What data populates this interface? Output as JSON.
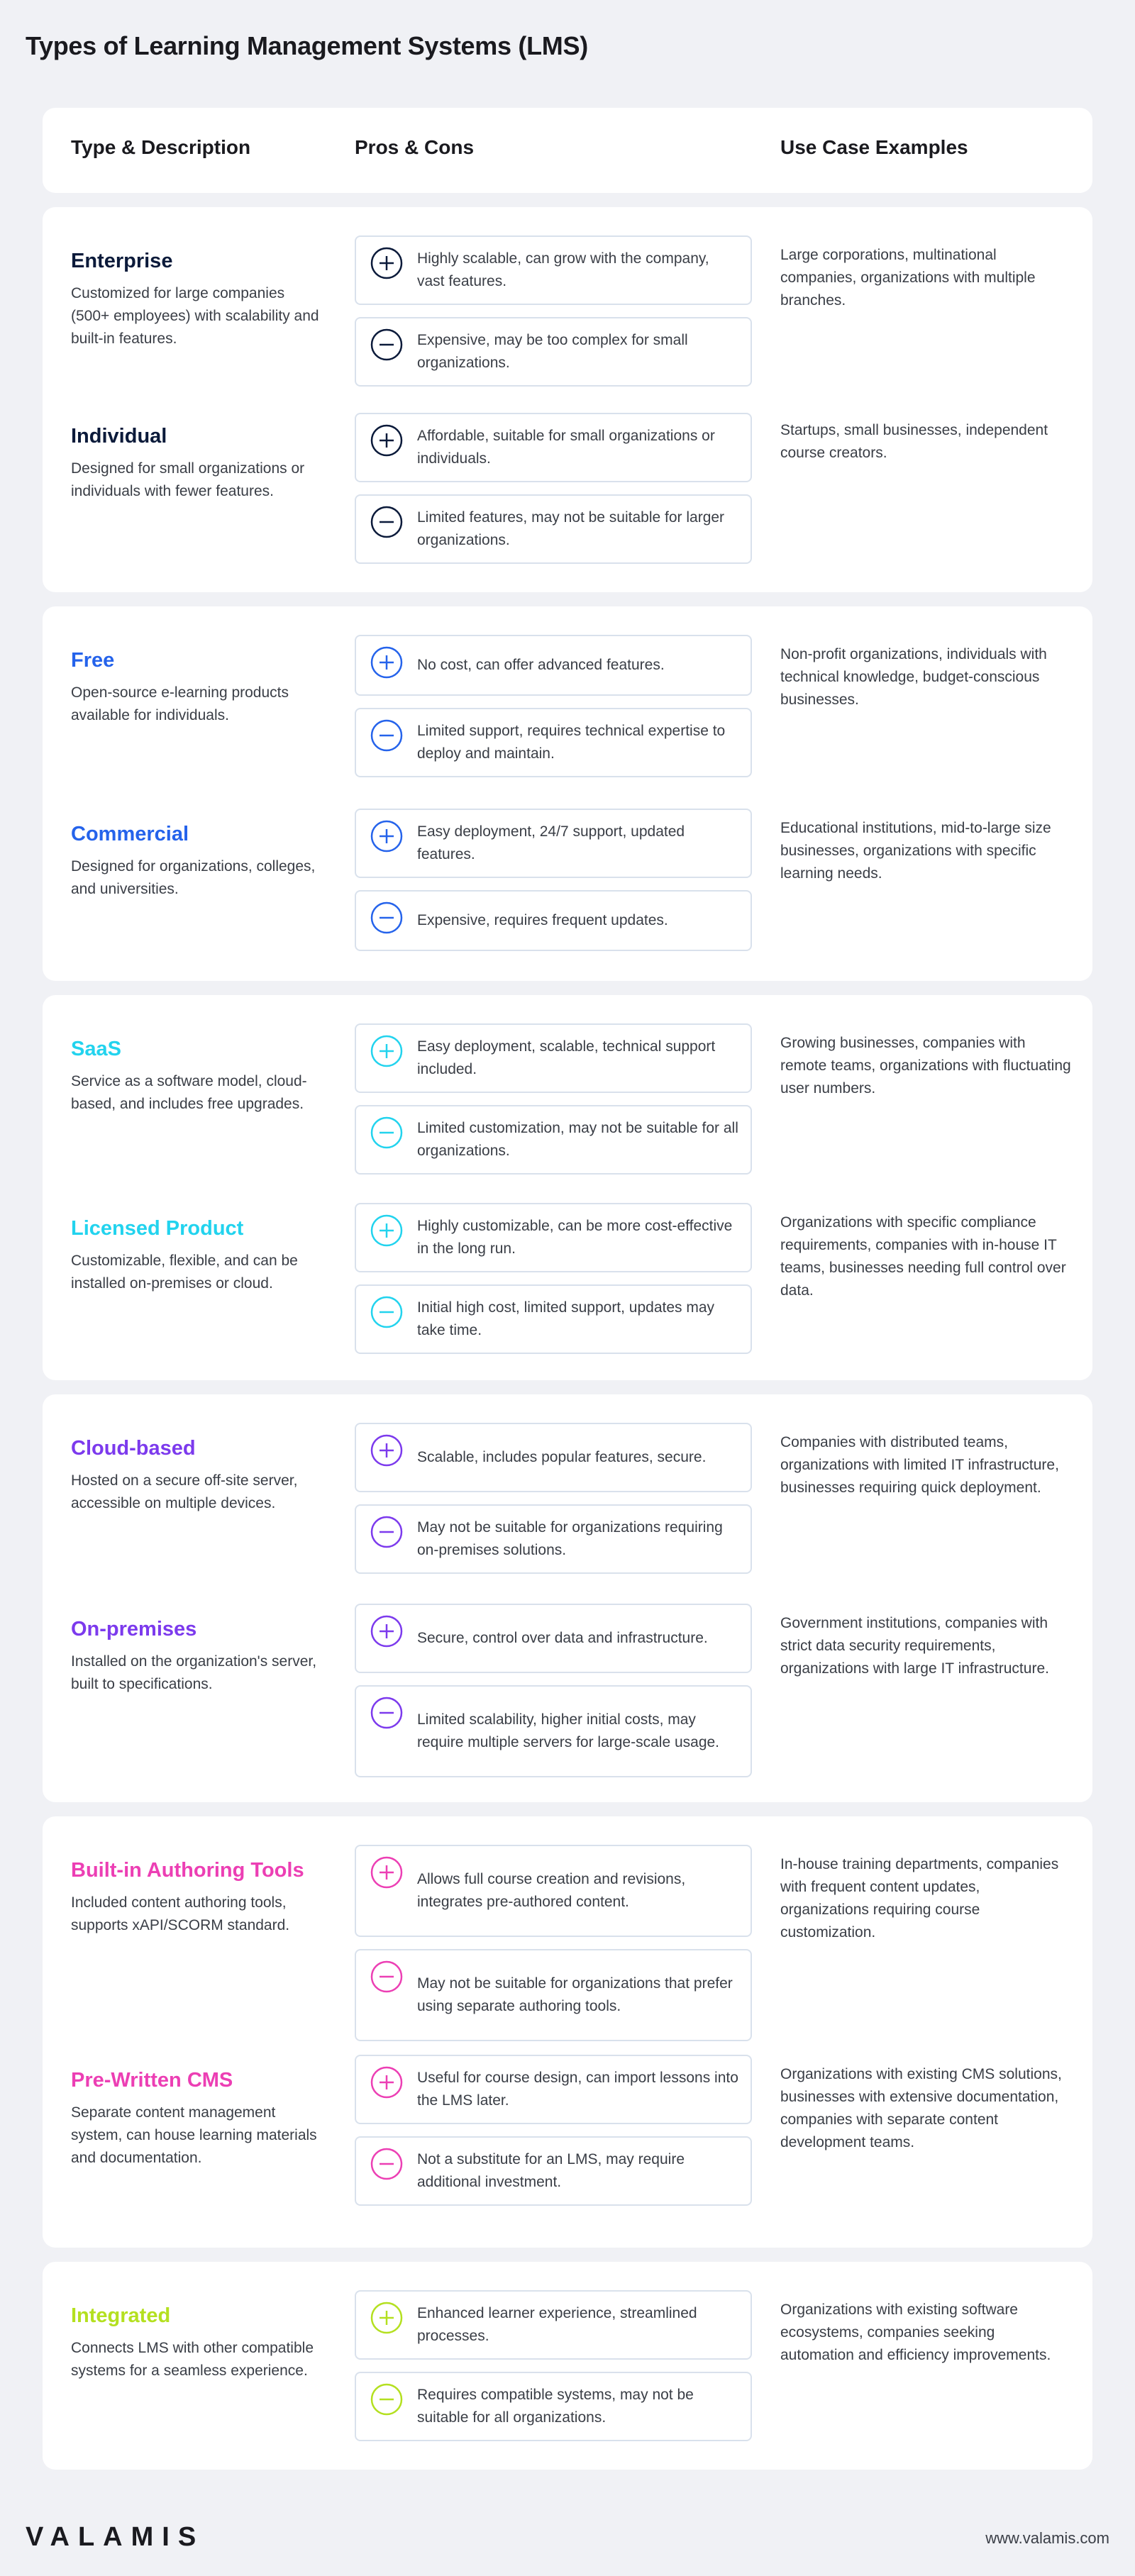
{
  "title": "Types of Learning Management Systems (LMS)",
  "columns": {
    "type": "Type & Description",
    "pros_cons": "Pros & Cons",
    "use_cases": "Use Case Examples"
  },
  "groups": [
    {
      "color": "#0b1a3a",
      "items": [
        {
          "name": "Enterprise",
          "desc": "Customized for large companies (500+ employees) with scalability and built-in features.",
          "pro": "Highly scalable, can grow with the company, vast features.",
          "con": "Expensive, may be too complex for small organizations.",
          "use": "Large corporations, multinational companies, organizations with multiple branches."
        },
        {
          "name": "Individual",
          "desc": "Designed for small organizations or individuals with fewer features.",
          "pro": "Affordable, suitable for small organizations or individuals.",
          "con": "Limited features, may not be suitable for larger organizations.",
          "use": "Startups, small businesses, independent course creators."
        }
      ]
    },
    {
      "color": "#2563eb",
      "items": [
        {
          "name": "Free",
          "desc": "Open-source e-learning products available for individuals.",
          "pro": "No cost, can offer advanced features.",
          "con": "Limited support, requires technical expertise to deploy and maintain.",
          "use": "Non-profit organizations, individuals with technical knowledge, budget-conscious businesses."
        },
        {
          "name": "Commercial",
          "desc": "Designed for organizations, colleges, and universities.",
          "pro": "Easy deployment, 24/7 support, updated features.",
          "con": "Expensive, requires frequent updates.",
          "use": "Educational institutions, mid-to-large size businesses, organizations with specific learning needs."
        }
      ]
    },
    {
      "color": "#22d3ee",
      "items": [
        {
          "name": "SaaS",
          "desc": "Service as a software model, cloud-based, and includes free upgrades.",
          "pro": "Easy deployment, scalable, technical support included.",
          "con": "Limited customization, may not be suitable for all organizations.",
          "use": "Growing businesses, companies with remote teams, organizations with fluctuating user numbers."
        },
        {
          "name": "Licensed Product",
          "desc": "Customizable, flexible, and can be installed on-premises or cloud.",
          "pro": "Highly customizable, can be more cost-effective in the long run.",
          "con": "Initial high cost, limited support, updates may take time.",
          "use": "Organizations with specific compliance requirements, companies with in-house IT teams, businesses needing full control over data."
        }
      ]
    },
    {
      "color": "#7c3aed",
      "items": [
        {
          "name": "Cloud-based",
          "desc": "Hosted on a secure off-site server, accessible on multiple devices.",
          "pro": "Scalable, includes popular features, secure.",
          "con": "May not be suitable for organizations requiring on-premises solutions.",
          "use": "Companies with distributed teams, organizations with limited IT infrastructure, businesses requiring quick deployment."
        },
        {
          "name": "On-premises",
          "desc": "Installed on the organization's server, built to specifications.",
          "pro": "Secure, control over data and infrastructure.",
          "con": "Limited scalability, higher initial costs, may require multiple servers for large-scale usage.",
          "use": "Government institutions, companies with strict data security requirements, organizations with large IT infrastructure."
        }
      ]
    },
    {
      "color": "#ec3fb4",
      "items": [
        {
          "name": "Built-in Authoring Tools",
          "desc": "Included content authoring tools, supports xAPI/SCORM standard.",
          "pro": "Allows full course creation and revisions, integrates pre-authored content.",
          "con": "May not be suitable for organizations that prefer using separate authoring tools.",
          "use": "In-house training departments, companies with frequent content updates, organizations requiring course customization."
        },
        {
          "name": "Pre-Written CMS",
          "desc": "Separate content management system, can house learning materials and documentation.",
          "pro": "Useful for course design, can import lessons into the LMS later.",
          "con": "Not a substitute for an LMS, may require additional investment.",
          "use": "Organizations with existing CMS solutions, businesses with extensive documentation, companies with separate content development teams."
        }
      ]
    },
    {
      "color": "#b4e020",
      "items": [
        {
          "name": "Integrated",
          "desc": "Connects LMS with other compatible systems for a seamless experience.",
          "pro": "Enhanced learner experience, streamlined processes.",
          "con": "Requires compatible systems, may not be suitable for all organizations.",
          "use": "Organizations with existing software ecosystems, companies seeking automation and efficiency improvements."
        }
      ]
    }
  ],
  "footer": {
    "logo": "VALAMIS",
    "url": "www.valamis.com"
  }
}
